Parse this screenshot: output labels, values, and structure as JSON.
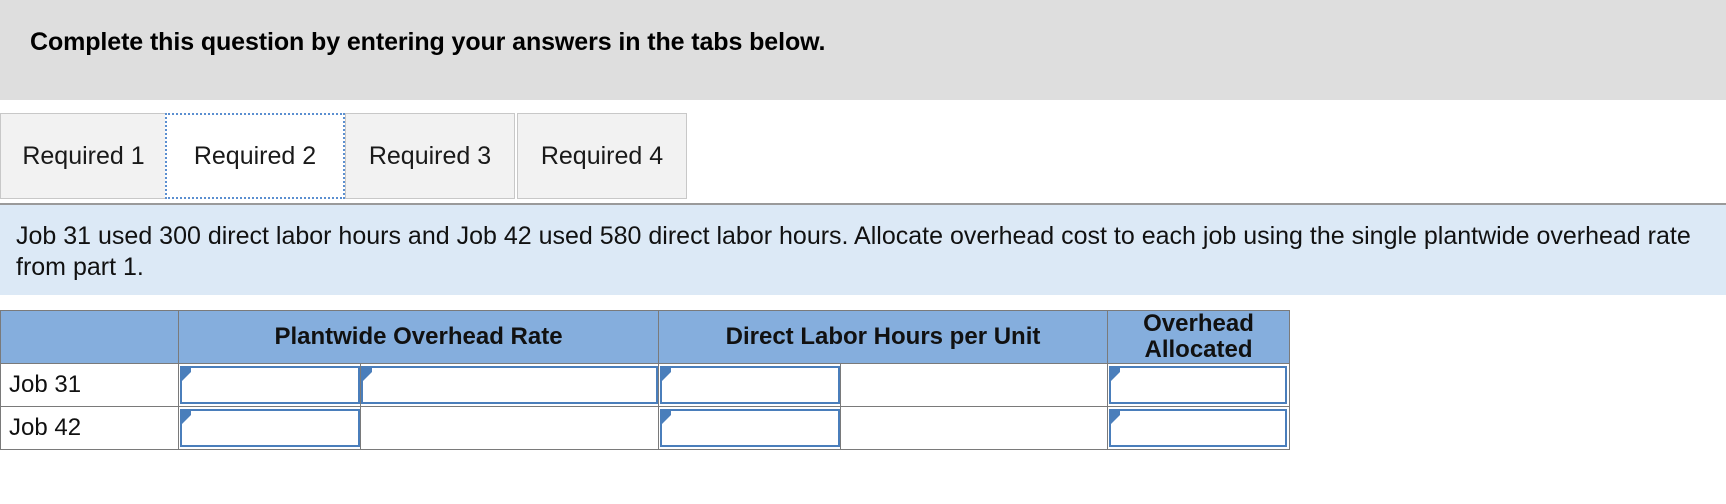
{
  "banner": {
    "text": "Complete this question by entering your answers in the tabs below."
  },
  "tabs": {
    "items": [
      {
        "label": "Required 1",
        "active": false
      },
      {
        "label": "Required 2",
        "active": true
      },
      {
        "label": "Required 3",
        "active": false
      },
      {
        "label": "Required 4",
        "active": false
      }
    ]
  },
  "instruction": {
    "text": "Job 31 used 300 direct labor hours and Job 42 used 580 direct labor hours. Allocate overhead cost to each job using the single plantwide overhead rate from part 1."
  },
  "table": {
    "headers": [
      "",
      "Plantwide Overhead Rate",
      "Direct Labor Hours per Unit",
      "Overhead Allocated"
    ],
    "rows": [
      {
        "label": "Job 31",
        "rate_a": "",
        "rate_b": "",
        "hours_a": "",
        "hours_b": "",
        "allocated": ""
      },
      {
        "label": "Job 42",
        "rate_a": "",
        "rate_b": "",
        "hours_a": "",
        "hours_b": "",
        "allocated": ""
      }
    ]
  },
  "colors": {
    "banner_bg": "#dedede",
    "instruction_bg": "#dce9f6",
    "table_header_bg": "#85aedd",
    "input_border": "#4a7ebb",
    "active_tab_border": "#5b8fd0"
  }
}
